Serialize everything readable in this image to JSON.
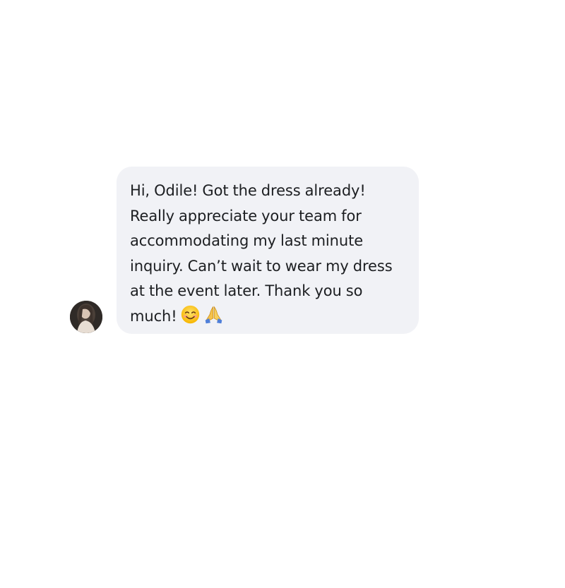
{
  "conversation": {
    "incoming_message": {
      "lines": [
        "Hi, Odile! Got the dress already!",
        "Really appreciate your team for",
        "accommodating my last minute",
        "inquiry. Can’t wait to wear my dress",
        "at the event later. Thank you so",
        "much!"
      ],
      "emojis": [
        "smiling-face-emoji",
        "folded-hands-emoji"
      ]
    },
    "avatar": "sender-avatar",
    "colors": {
      "bubble_background": "#f1f2f6",
      "text": "#1c1e21",
      "page_background": "#ffffff"
    }
  }
}
